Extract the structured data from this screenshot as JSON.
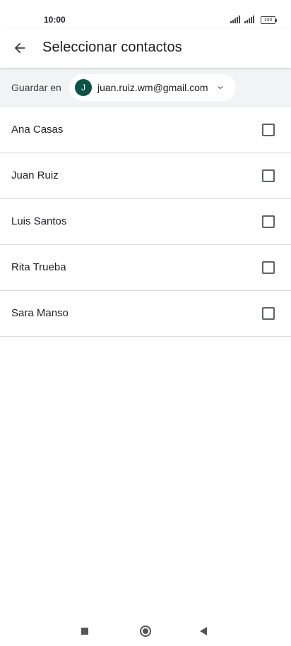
{
  "status_bar": {
    "time": "10:00",
    "battery": "100"
  },
  "app_bar": {
    "back_icon": "arrow-back-icon",
    "title": "Seleccionar contactos"
  },
  "save_bar": {
    "label": "Guardar en",
    "account": {
      "initial": "J",
      "email": "juan.ruiz.wm@gmail.com",
      "avatar_color": "#0d5247",
      "chevron_icon": "chevron-down-icon"
    }
  },
  "contacts": [
    {
      "name": "Ana Casas",
      "checked": false
    },
    {
      "name": "Juan Ruiz",
      "checked": false
    },
    {
      "name": "Luis Santos",
      "checked": false
    },
    {
      "name": "Rita Trueba",
      "checked": false
    },
    {
      "name": "Sara Manso",
      "checked": false
    }
  ],
  "nav_bar": {
    "icons": [
      "recents-square-icon",
      "home-circle-icon",
      "back-triangle-icon"
    ]
  },
  "colors": {
    "save_bar_bg": "#f1f3f4",
    "divider": "#dadce0",
    "text_primary": "#202124"
  }
}
